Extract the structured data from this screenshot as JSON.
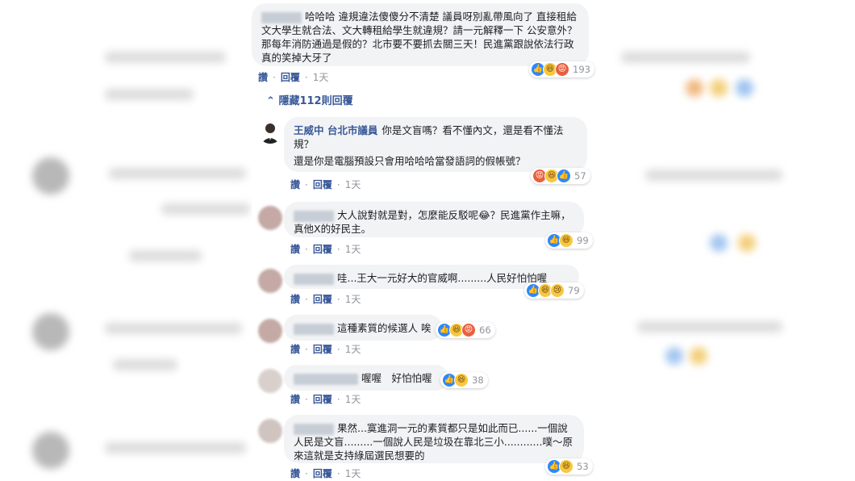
{
  "comments": [
    {
      "text": "哈哈哈 違規違法傻傻分不清楚 議員呀別亂帶風向了 直接租給文大學生就合法、文大轉租給學生就違規？請一元解釋一下 公安意外？那每年消防通過是假的？北市要不要抓去關三天！民進黨跟說依法行政 真的笑掉大牙了",
      "reactions_count": "193",
      "reactions": [
        "like",
        "haha",
        "angry"
      ],
      "time": "1天"
    },
    {
      "author": "王威中 台北市議員",
      "text": "你是文盲嗎？看不懂內文，還是看不懂法規？",
      "text2": "還是你是電腦預設只會用哈哈哈當發語詞的假帳號？",
      "reactions_count": "57",
      "reactions": [
        "angry",
        "haha",
        "like"
      ],
      "time": "1天"
    },
    {
      "text": "大人說對就是對，怎麼能反駁呢😂？民進黨作主嘛，真他X的好民主。",
      "reactions_count": "99",
      "reactions": [
        "like",
        "haha"
      ],
      "time": "1天"
    },
    {
      "text": "哇...王大一元好大的官威啊.........人民好怕怕喔",
      "reactions_count": "79",
      "reactions": [
        "like",
        "haha",
        "sad"
      ],
      "time": "1天"
    },
    {
      "text": "這種素質的候選人 唉",
      "reactions_count": "66",
      "reactions": [
        "like",
        "haha",
        "angry"
      ],
      "time": "1天"
    },
    {
      "text": "喔喔　好怕怕喔",
      "reactions_count": "38",
      "reactions": [
        "like",
        "haha"
      ],
      "time": "1天"
    },
    {
      "text": "果然...寞進洞一元的素質都只是如此而已......一個說人民是文盲.........一個說人民是垃圾在靠北三小............噗～原來這就是支持綠屆選民想要的",
      "reactions_count": "53",
      "reactions": [
        "like",
        "haha"
      ],
      "time": "1天"
    }
  ],
  "actions": {
    "like": "讚",
    "reply": "回覆",
    "dot": "·"
  },
  "hide_replies": "隱藏112則回覆",
  "colors": {
    "link": "#385898",
    "bubble": "#f2f3f5",
    "like": "#2d88ff"
  }
}
